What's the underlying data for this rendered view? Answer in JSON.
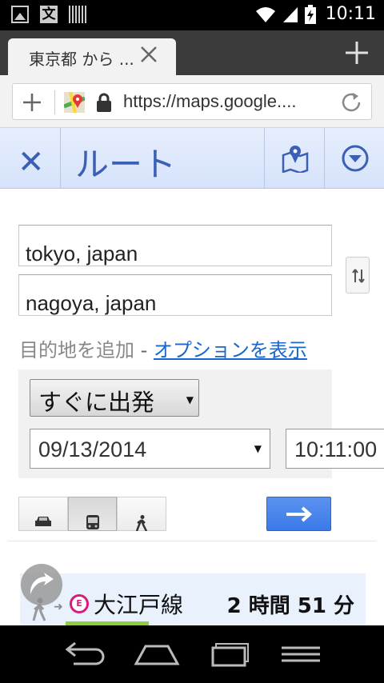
{
  "status_bar": {
    "time": "10:11",
    "text_icon_glyph": "文"
  },
  "browser": {
    "tab_title": "東京都 から ...",
    "url": "https://maps.google...."
  },
  "route_header": {
    "close_glyph": "✕",
    "title": "ルート"
  },
  "form": {
    "origin": "tokyo, japan",
    "destination": "nagoya, japan",
    "add_destination": "目的地を追加",
    "separator": " - ",
    "show_options": "オプションを表示",
    "depart_option": "すぐに出発",
    "date": "09/13/2014",
    "time": "10:11:00",
    "dropdown_arrow": "▼",
    "travel_modes": [
      {
        "name": "car",
        "active": false
      },
      {
        "name": "transit",
        "active": true
      },
      {
        "name": "walk",
        "active": false
      }
    ]
  },
  "result": {
    "line_badge": "E",
    "line_name": "大江戸線",
    "duration": "2 時間 51 分",
    "arrow_glyph": "➜"
  },
  "colors": {
    "link": "#1a66cc",
    "header_text": "#3a5fb5",
    "go_button": "#4285f4",
    "line_badge": "#d81b7e",
    "progress": "#8fcf3a"
  }
}
